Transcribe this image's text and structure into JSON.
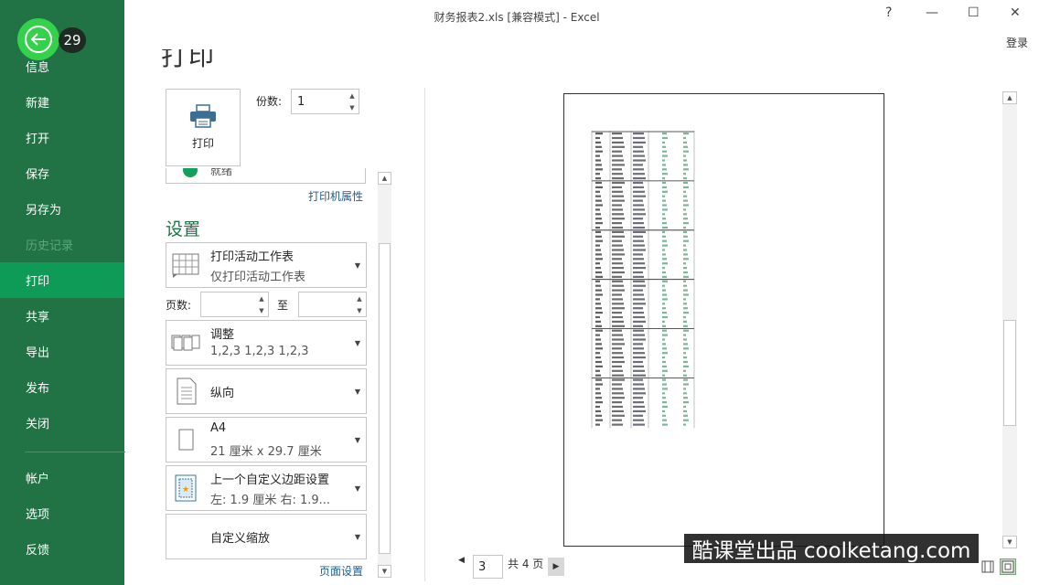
{
  "window": {
    "title": "财务报表2.xls  [兼容模式] - Excel",
    "help": "?",
    "minimize": "—",
    "maximize": "☐",
    "close": "✕",
    "login": "登录"
  },
  "nav": {
    "badge": "29",
    "items": [
      "信息",
      "新建",
      "打开",
      "保存",
      "另存为",
      "历史记录",
      "打印",
      "共享",
      "导出",
      "发布",
      "关闭",
      "帐户",
      "选项",
      "反馈"
    ],
    "active": "打印",
    "disabled": "历史记录"
  },
  "print": {
    "heading": "打印",
    "button_label": "打印",
    "copies_label": "份数:",
    "copies_value": "1",
    "printer_status": "就绪",
    "printer_properties": "打印机属性"
  },
  "settings": {
    "heading": "设置",
    "scope": {
      "title": "打印活动工作表",
      "subtitle": "仅打印活动工作表"
    },
    "pages_label": "页数:",
    "to_label": "至",
    "collate": {
      "title": "调整",
      "subtitle": "1,2,3    1,2,3    1,2,3"
    },
    "orientation": {
      "title": "纵向"
    },
    "paper": {
      "title": "A4",
      "subtitle": "21 厘米 x 29.7 厘米"
    },
    "margins": {
      "title": "上一个自定义边距设置",
      "subtitle": "左:  1.9 厘米    右:  1.9..."
    },
    "scaling": {
      "title": "自定义缩放"
    },
    "page_setup": "页面设置"
  },
  "preview": {
    "current_page": "3",
    "total_pages": "共 4 页"
  },
  "watermark": "酷课堂出品 coolketang.com"
}
